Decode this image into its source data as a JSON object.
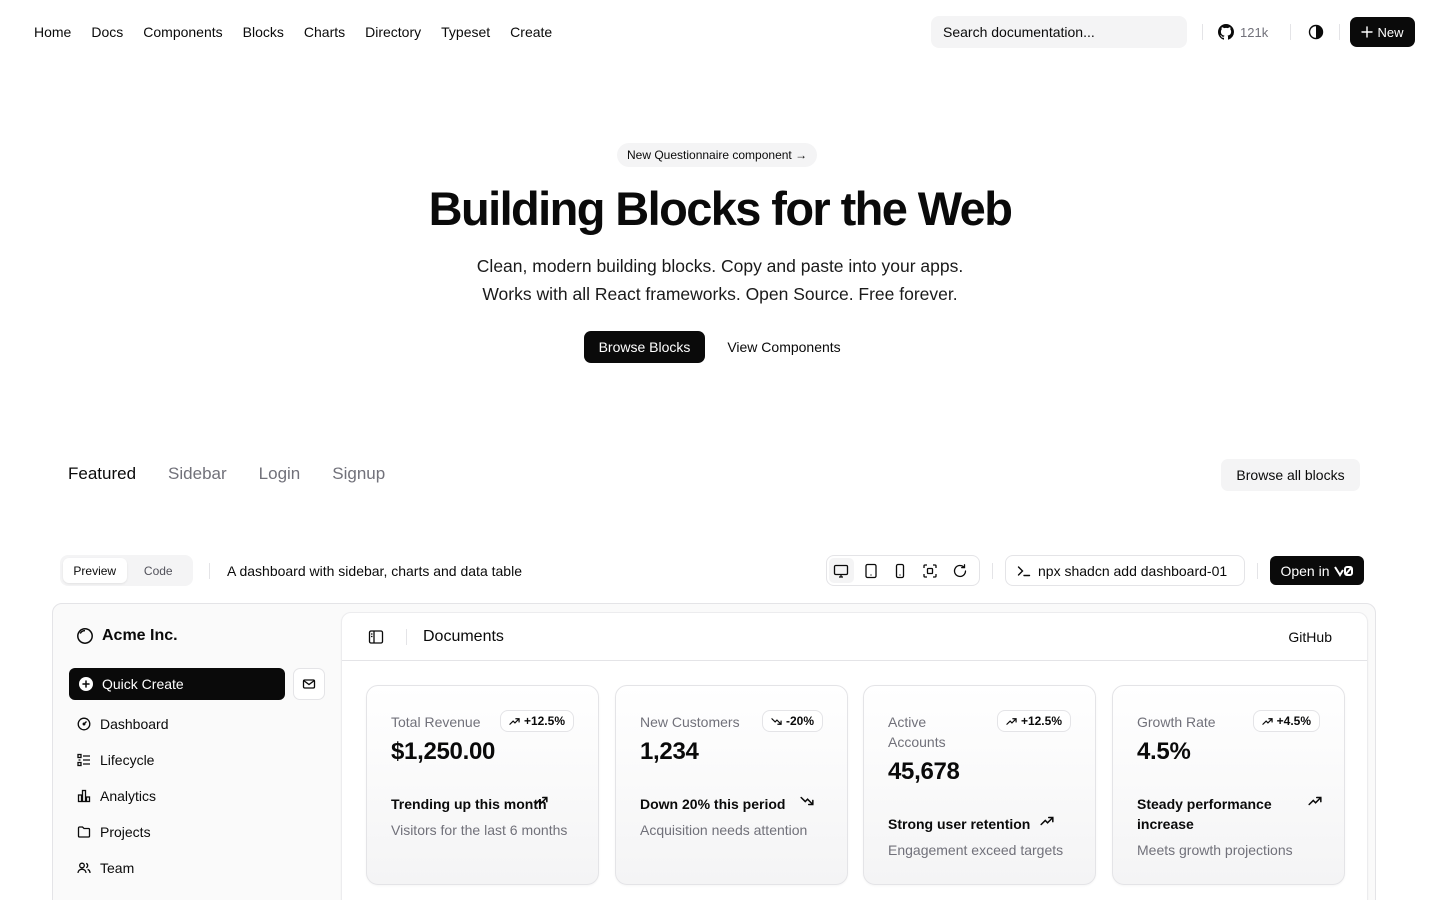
{
  "nav": {
    "links": [
      "Home",
      "Docs",
      "Components",
      "Blocks",
      "Charts",
      "Directory",
      "Typeset",
      "Create"
    ],
    "search_placeholder": "Search documentation...",
    "github_stars": "121k",
    "new_label": "New"
  },
  "hero": {
    "pill": "New Questionnaire component",
    "title": "Building Blocks for the Web",
    "subtitle_line1": "Clean, modern building blocks. Copy and paste into your apps.",
    "subtitle_line2": "Works with all React frameworks. Open Source. Free forever.",
    "primary_cta": "Browse Blocks",
    "secondary_cta": "View Components"
  },
  "tabs": {
    "items": [
      "Featured",
      "Sidebar",
      "Login",
      "Signup"
    ],
    "active": "Featured",
    "browse_all": "Browse all blocks"
  },
  "toolbar": {
    "preview": "Preview",
    "code": "Code",
    "description": "A dashboard with sidebar, charts and data table",
    "command": "npx shadcn add dashboard-01",
    "open_in": "Open in"
  },
  "preview": {
    "brand": "Acme Inc.",
    "quick_create": "Quick Create",
    "sidebar_items": [
      {
        "label": "Dashboard",
        "icon": "dashboard-icon"
      },
      {
        "label": "Lifecycle",
        "icon": "list-icon"
      },
      {
        "label": "Analytics",
        "icon": "bar-chart-icon"
      },
      {
        "label": "Projects",
        "icon": "folder-icon"
      },
      {
        "label": "Team",
        "icon": "users-icon"
      }
    ],
    "header_title": "Documents",
    "header_github": "GitHub",
    "cards": [
      {
        "label": "Total Revenue",
        "badge": "+12.5%",
        "direction": "up",
        "value": "$1,250.00",
        "trend": "Trending up this month",
        "foot": "Visitors for the last 6 months"
      },
      {
        "label": "New Customers",
        "badge": "-20%",
        "direction": "down",
        "value": "1,234",
        "trend": "Down 20% this period",
        "foot": "Acquisition needs attention"
      },
      {
        "label": "Active Accounts",
        "badge": "+12.5%",
        "direction": "up",
        "value": "45,678",
        "trend": "Strong user retention",
        "foot": "Engagement exceed targets"
      },
      {
        "label": "Growth Rate",
        "badge": "+4.5%",
        "direction": "up",
        "value": "4.5%",
        "trend": "Steady performance increase",
        "foot": "Meets growth projections"
      }
    ]
  }
}
